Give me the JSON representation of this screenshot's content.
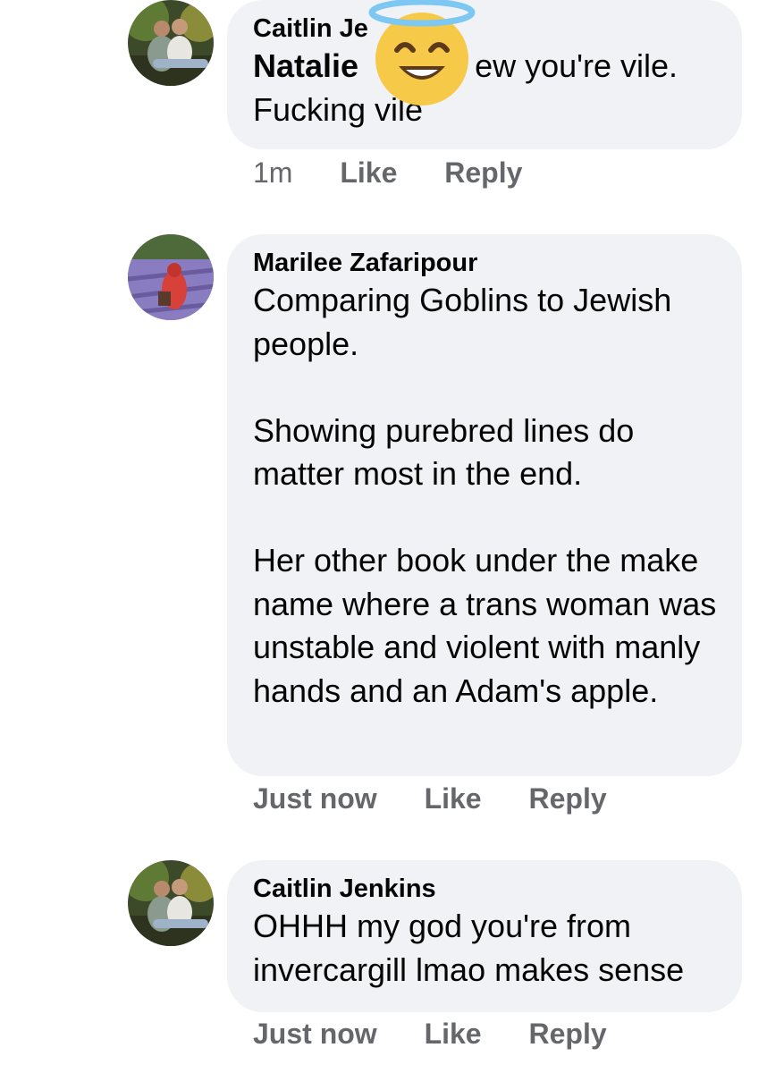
{
  "comments": [
    {
      "author": "Caitlin Je",
      "mention": "Natalie",
      "text_lines": [
        "ew you're vile.",
        "Fucking vile"
      ],
      "time": "1m",
      "like_label": "Like",
      "reply_label": "Reply",
      "avatar_icon": "couple-photo-avatar"
    },
    {
      "author": "Marilee Zafaripour",
      "paragraphs": [
        "Comparing Goblins to Jewish people.",
        "Showing purebred lines do matter most in the end.",
        "Her other book under the make name where a trans woman was unstable and violent with manly hands and an Adam's apple."
      ],
      "time": "Just now",
      "like_label": "Like",
      "reply_label": "Reply",
      "avatar_icon": "lavender-field-avatar"
    },
    {
      "author": "Caitlin Jenkins",
      "text": "OHHH my god you're from invercargill lmao makes sense",
      "time": "Just now",
      "like_label": "Like",
      "reply_label": "Reply",
      "avatar_icon": "couple-photo-avatar"
    }
  ],
  "overlay": {
    "emoji": "smiling-face-with-halo-icon"
  },
  "colors": {
    "bubble": "#f0f2f5",
    "meta": "#65676b",
    "emoji_yellow": "#f7c948",
    "halo_blue": "#7cc8f2"
  }
}
